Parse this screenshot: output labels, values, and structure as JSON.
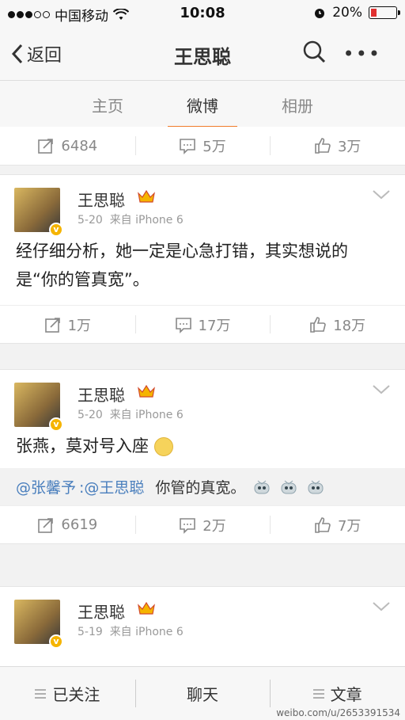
{
  "status": {
    "carrier": "中国移动",
    "time": "10:08",
    "battery": "20%"
  },
  "nav": {
    "back_label": "返回",
    "title": "王思聪"
  },
  "tabs": [
    {
      "label": "主页"
    },
    {
      "label": "微博"
    },
    {
      "label": "相册"
    }
  ],
  "top_actions": {
    "repost": "6484",
    "comment": "5万",
    "like": "3万"
  },
  "posts": [
    {
      "name": "王思聪",
      "date": "5-20",
      "source": "来自 iPhone 6",
      "text": "经仔细分析，她一定是心急打错，其实想说的是“你的管真宽”。",
      "repost": "1万",
      "comment": "17万",
      "like": "18万"
    },
    {
      "name": "王思聪",
      "date": "5-20",
      "source": "来自 iPhone 6",
      "text": "张燕，莫对号入座",
      "quote_user": "@张馨予",
      "quote_mention": ":@王思聪",
      "quote_text": "你管的真宽。",
      "repost": "6619",
      "comment": "2万",
      "like": "7万"
    },
    {
      "name": "王思聪",
      "date": "5-19",
      "source": "来自 iPhone 6"
    }
  ],
  "bottom_bar": {
    "follow": "已关注",
    "chat": "聊天",
    "articles": "文章"
  },
  "watermark": "weibo.com/u/2653391534",
  "colors": {
    "accent": "#f07c2a",
    "link": "#4a7fbd",
    "battery_low": "#e03030"
  }
}
